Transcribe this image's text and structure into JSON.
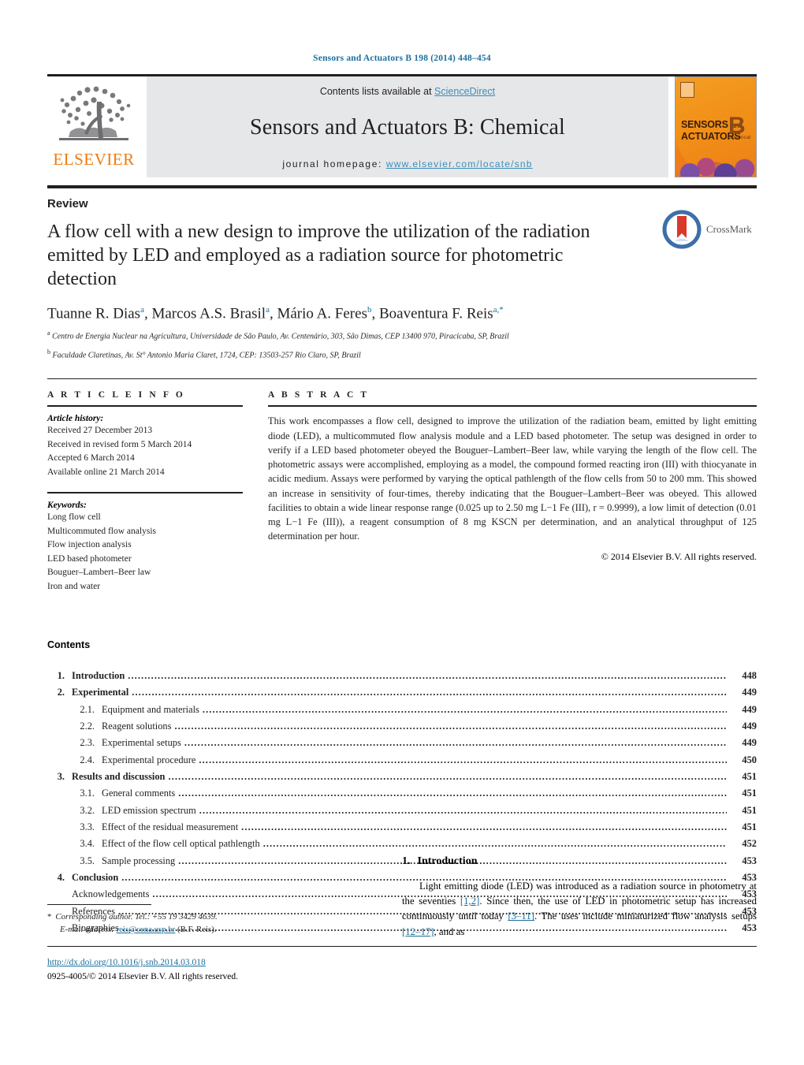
{
  "running_head": "Sensors and Actuators B 198 (2014) 448–454",
  "masthead": {
    "publisher_name": "ELSEVIER",
    "contents_prefix": "Contents lists available at ",
    "sciencedirect": "ScienceDirect",
    "journal_title": "Sensors and Actuators B: Chemical",
    "homepage_prefix": "journal homepage: ",
    "homepage_url": "www.elsevier.com/locate/snb",
    "cover": {
      "line1": "SENSORS",
      "and": "and",
      "line2": "ACTUATORS",
      "letter": "B",
      "sub": "Chemical"
    }
  },
  "article": {
    "doctype": "Review",
    "title": "A flow cell with a new design to improve the utilization of the radiation emitted by LED and employed as a radiation source for photometric detection",
    "crossmark_label": "CrossMark",
    "authors_html": "Tuanne R. Dias<sup>a</sup>, Marcos A.S. Brasil<sup>a</sup>, Mário A. Feres<sup>b</sup>, Boaventura F. Reis<sup>a,</sup><sup>*</sup>",
    "affiliations": [
      "Centro de Energia Nuclear na Agricultura, Universidade de São Paulo, Av. Centenário, 303, São Dimas, CEP 13400 970, Piracicaba, SP, Brazil",
      "Faculdade Claretinas, Av. St° Antonio Maria Claret, 1724, CEP: 13503-257 Rio Claro, SP, Brazil"
    ],
    "affil_marks": [
      "a",
      "b"
    ]
  },
  "article_info": {
    "heading": "A R T I C L E   I N F O",
    "history_title": "Article history:",
    "history": [
      "Received 27 December 2013",
      "Received in revised form 5 March 2014",
      "Accepted 6 March 2014",
      "Available online 21 March 2014"
    ],
    "keywords_title": "Keywords:",
    "keywords": [
      "Long flow cell",
      "Multicommuted flow analysis",
      "Flow injection analysis",
      "LED based photometer",
      "Bouguer–Lambert–Beer law",
      "Iron and water"
    ]
  },
  "abstract": {
    "heading": "A B S T R A C T",
    "text": "This work encompasses a flow cell, designed to improve the utilization of the radiation beam, emitted by light emitting diode (LED), a multicommuted flow analysis module and a LED based photometer. The setup was designed in order to verify if a LED based photometer obeyed the Bouguer–Lambert–Beer law, while varying the length of the flow cell. The photometric assays were accomplished, employing as a model, the compound formed reacting iron (III) with thiocyanate in acidic medium. Assays were performed by varying the optical pathlength of the flow cells from 50 to 200 mm. This showed an increase in sensitivity of four-times, thereby indicating that the Bouguer–Lambert–Beer was obeyed. This allowed facilities to obtain a wide linear response range (0.025 up to 2.50 mg L−1 Fe (III), r = 0.9999), a low limit of detection (0.01 mg L−1 Fe (III)), a reagent consumption of 8 mg KSCN per determination, and an analytical throughput of 125 determination per hour.",
    "copyright": "© 2014 Elsevier B.V. All rights reserved."
  },
  "contents": {
    "title": "Contents",
    "rows": [
      {
        "level": 1,
        "num": "1.",
        "label": "Introduction",
        "page": "448"
      },
      {
        "level": 1,
        "num": "2.",
        "label": "Experimental",
        "page": "449"
      },
      {
        "level": 2,
        "num": "2.1.",
        "label": "Equipment and materials",
        "page": "449"
      },
      {
        "level": 2,
        "num": "2.2.",
        "label": "Reagent solutions",
        "page": "449"
      },
      {
        "level": 2,
        "num": "2.3.",
        "label": "Experimental setups",
        "page": "449"
      },
      {
        "level": 2,
        "num": "2.4.",
        "label": "Experimental procedure",
        "page": "450"
      },
      {
        "level": 1,
        "num": "3.",
        "label": "Results and discussion",
        "page": "451"
      },
      {
        "level": 2,
        "num": "3.1.",
        "label": "General comments",
        "page": "451"
      },
      {
        "level": 2,
        "num": "3.2.",
        "label": "LED emission spectrum",
        "page": "451"
      },
      {
        "level": 2,
        "num": "3.3.",
        "label": "Effect of the residual measurement",
        "page": "451"
      },
      {
        "level": 2,
        "num": "3.4.",
        "label": "Effect of the flow cell optical pathlength",
        "page": "452"
      },
      {
        "level": 2,
        "num": "3.5.",
        "label": "Sample processing",
        "page": "453"
      },
      {
        "level": 1,
        "num": "4.",
        "label": "Conclusion",
        "page": "453"
      },
      {
        "level": 0,
        "num": "",
        "label": "Acknowledgements",
        "page": "453"
      },
      {
        "level": 0,
        "num": "",
        "label": "References",
        "page": "453"
      },
      {
        "level": 0,
        "num": "",
        "label": "Biographies",
        "page": "453"
      }
    ]
  },
  "footer": {
    "corresponding_star": "*",
    "corresponding": "Corresponding author. Tel.: +55 19 3429 4639.",
    "email_label": "E-mail address:",
    "email": "reis@cena.usp.br",
    "email_owner": "(B.F. Reis).",
    "doi_url": "http://dx.doi.org/10.1016/j.snb.2014.03.018",
    "issn_line": "0925-4005/© 2014 Elsevier B.V. All rights reserved."
  },
  "introduction": {
    "number": "1.",
    "heading": "Introduction",
    "paragraph_parts": [
      "Light emitting diode (LED) was introduced as a radiation source in photometry at the seventies ",
      "[1,2]",
      ". Since then, the use of LED in photometric setup has increased continuously until today ",
      "[3–11]",
      ". The uses include miniaturized flow analysis setups ",
      "[12–17]",
      ", and as"
    ]
  },
  "colors": {
    "link_blue": "#1a6f9c",
    "sciencedirect_blue": "#3c8dbc",
    "elsevier_orange": "#ef7b10",
    "band_gray": "#e6e7e8",
    "rule_black": "#231f20"
  }
}
